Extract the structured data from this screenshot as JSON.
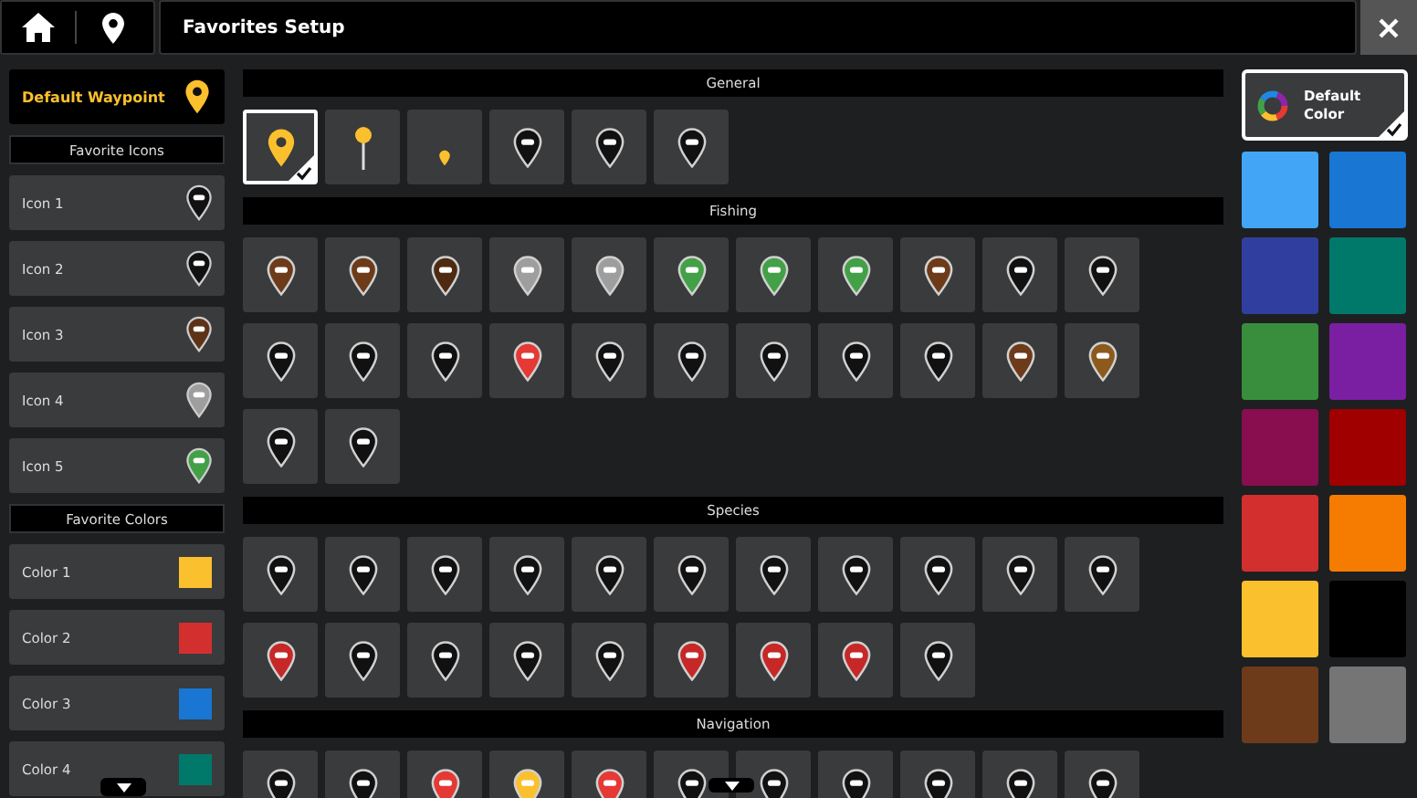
{
  "window": {
    "title": "Favorites Setup"
  },
  "sidebar": {
    "default_waypoint": {
      "label": "Default Waypoint",
      "color": "#fbc02d"
    },
    "icons_heading": "Favorite Icons",
    "icons": [
      {
        "label": "Icon 1",
        "color": "#111111"
      },
      {
        "label": "Icon 2",
        "color": "#111111"
      },
      {
        "label": "Icon 3",
        "color": "#5d3317"
      },
      {
        "label": "Icon 4",
        "color": "#9e9e9e"
      },
      {
        "label": "Icon 5",
        "color": "#43a047"
      }
    ],
    "colors_heading": "Favorite Colors",
    "colors": [
      {
        "label": "Color 1",
        "color": "#fbc02d"
      },
      {
        "label": "Color 2",
        "color": "#d32f2f"
      },
      {
        "label": "Color 3",
        "color": "#1976d2"
      },
      {
        "label": "Color 4",
        "color": "#00796b"
      }
    ]
  },
  "sections": [
    {
      "title": "General",
      "icons": [
        {
          "kind": "marker",
          "color": "#fbc02d",
          "selected": true
        },
        {
          "kind": "stick",
          "color": "#fbc02d",
          "selected": false
        },
        {
          "kind": "dot",
          "color": "#fbc02d",
          "selected": false
        },
        {
          "kind": "marker",
          "color": "#111111",
          "selected": false
        },
        {
          "kind": "marker",
          "color": "#111111",
          "selected": false
        },
        {
          "kind": "marker",
          "color": "#111111",
          "selected": false
        }
      ]
    },
    {
      "title": "Fishing",
      "icons": [
        {
          "kind": "marker",
          "color": "#6d3b1a",
          "selected": false
        },
        {
          "kind": "marker",
          "color": "#6d3b1a",
          "selected": false
        },
        {
          "kind": "marker",
          "color": "#4e2a12",
          "selected": false
        },
        {
          "kind": "marker",
          "color": "#9e9e9e",
          "selected": false
        },
        {
          "kind": "marker",
          "color": "#9e9e9e",
          "selected": false
        },
        {
          "kind": "marker",
          "color": "#43a047",
          "selected": false
        },
        {
          "kind": "marker",
          "color": "#43a047",
          "selected": false
        },
        {
          "kind": "marker",
          "color": "#43a047",
          "selected": false
        },
        {
          "kind": "marker",
          "color": "#6d3b1a",
          "selected": false
        },
        {
          "kind": "marker",
          "color": "#111111",
          "selected": false
        },
        {
          "kind": "marker",
          "color": "#111111",
          "selected": false
        },
        {
          "kind": "marker",
          "color": "#111111",
          "selected": false
        },
        {
          "kind": "marker",
          "color": "#111111",
          "selected": false
        },
        {
          "kind": "marker",
          "color": "#111111",
          "selected": false
        },
        {
          "kind": "marker",
          "color": "#e53935",
          "selected": false
        },
        {
          "kind": "marker",
          "color": "#111111",
          "selected": false
        },
        {
          "kind": "marker",
          "color": "#111111",
          "selected": false
        },
        {
          "kind": "marker",
          "color": "#111111",
          "selected": false
        },
        {
          "kind": "marker",
          "color": "#111111",
          "selected": false
        },
        {
          "kind": "marker",
          "color": "#111111",
          "selected": false
        },
        {
          "kind": "marker",
          "color": "#6d3b1a",
          "selected": false
        },
        {
          "kind": "marker",
          "color": "#8d5a1e",
          "selected": false
        },
        {
          "kind": "marker",
          "color": "#111111",
          "selected": false
        },
        {
          "kind": "marker",
          "color": "#111111",
          "selected": false
        }
      ]
    },
    {
      "title": "Species",
      "icons": [
        {
          "kind": "marker",
          "color": "#111111",
          "selected": false
        },
        {
          "kind": "marker",
          "color": "#111111",
          "selected": false
        },
        {
          "kind": "marker",
          "color": "#111111",
          "selected": false
        },
        {
          "kind": "marker",
          "color": "#111111",
          "selected": false
        },
        {
          "kind": "marker",
          "color": "#111111",
          "selected": false
        },
        {
          "kind": "marker",
          "color": "#111111",
          "selected": false
        },
        {
          "kind": "marker",
          "color": "#111111",
          "selected": false
        },
        {
          "kind": "marker",
          "color": "#111111",
          "selected": false
        },
        {
          "kind": "marker",
          "color": "#111111",
          "selected": false
        },
        {
          "kind": "marker",
          "color": "#111111",
          "selected": false
        },
        {
          "kind": "marker",
          "color": "#111111",
          "selected": false
        },
        {
          "kind": "marker",
          "color": "#c62828",
          "selected": false
        },
        {
          "kind": "marker",
          "color": "#111111",
          "selected": false
        },
        {
          "kind": "marker",
          "color": "#111111",
          "selected": false
        },
        {
          "kind": "marker",
          "color": "#111111",
          "selected": false
        },
        {
          "kind": "marker",
          "color": "#111111",
          "selected": false
        },
        {
          "kind": "marker",
          "color": "#c62828",
          "selected": false
        },
        {
          "kind": "marker",
          "color": "#c62828",
          "selected": false
        },
        {
          "kind": "marker",
          "color": "#c62828",
          "selected": false
        },
        {
          "kind": "marker",
          "color": "#111111",
          "selected": false
        }
      ]
    },
    {
      "title": "Navigation",
      "icons": [
        {
          "kind": "marker",
          "color": "#111111",
          "selected": false
        },
        {
          "kind": "marker",
          "color": "#111111",
          "selected": false
        },
        {
          "kind": "marker",
          "color": "#e53935",
          "selected": false
        },
        {
          "kind": "marker",
          "color": "#fbc02d",
          "selected": false
        },
        {
          "kind": "marker",
          "color": "#e53935",
          "selected": false
        },
        {
          "kind": "marker",
          "color": "#111111",
          "selected": false
        },
        {
          "kind": "marker",
          "color": "#111111",
          "selected": false
        },
        {
          "kind": "marker",
          "color": "#111111",
          "selected": false
        },
        {
          "kind": "marker",
          "color": "#111111",
          "selected": false
        },
        {
          "kind": "marker",
          "color": "#111111",
          "selected": false
        },
        {
          "kind": "marker",
          "color": "#111111",
          "selected": false
        }
      ]
    }
  ],
  "palette": {
    "default": {
      "label": "Default Color",
      "selected": true
    },
    "colors": [
      {
        "color": "#42a5f5",
        "selected": false
      },
      {
        "color": "#1976d2",
        "selected": false
      },
      {
        "color": "#303f9f",
        "selected": false
      },
      {
        "color": "#00796b",
        "selected": false
      },
      {
        "color": "#388e3c",
        "selected": false
      },
      {
        "color": "#7b1fa2",
        "selected": false
      },
      {
        "color": "#880e4f",
        "selected": false
      },
      {
        "color": "#a00000",
        "selected": false
      },
      {
        "color": "#d32f2f",
        "selected": false
      },
      {
        "color": "#f57c00",
        "selected": false
      },
      {
        "color": "#fbc02d",
        "selected": false
      },
      {
        "color": "#000000",
        "selected": false
      },
      {
        "color": "#6d3b1a",
        "selected": false
      },
      {
        "color": "#757575",
        "selected": false
      }
    ]
  }
}
